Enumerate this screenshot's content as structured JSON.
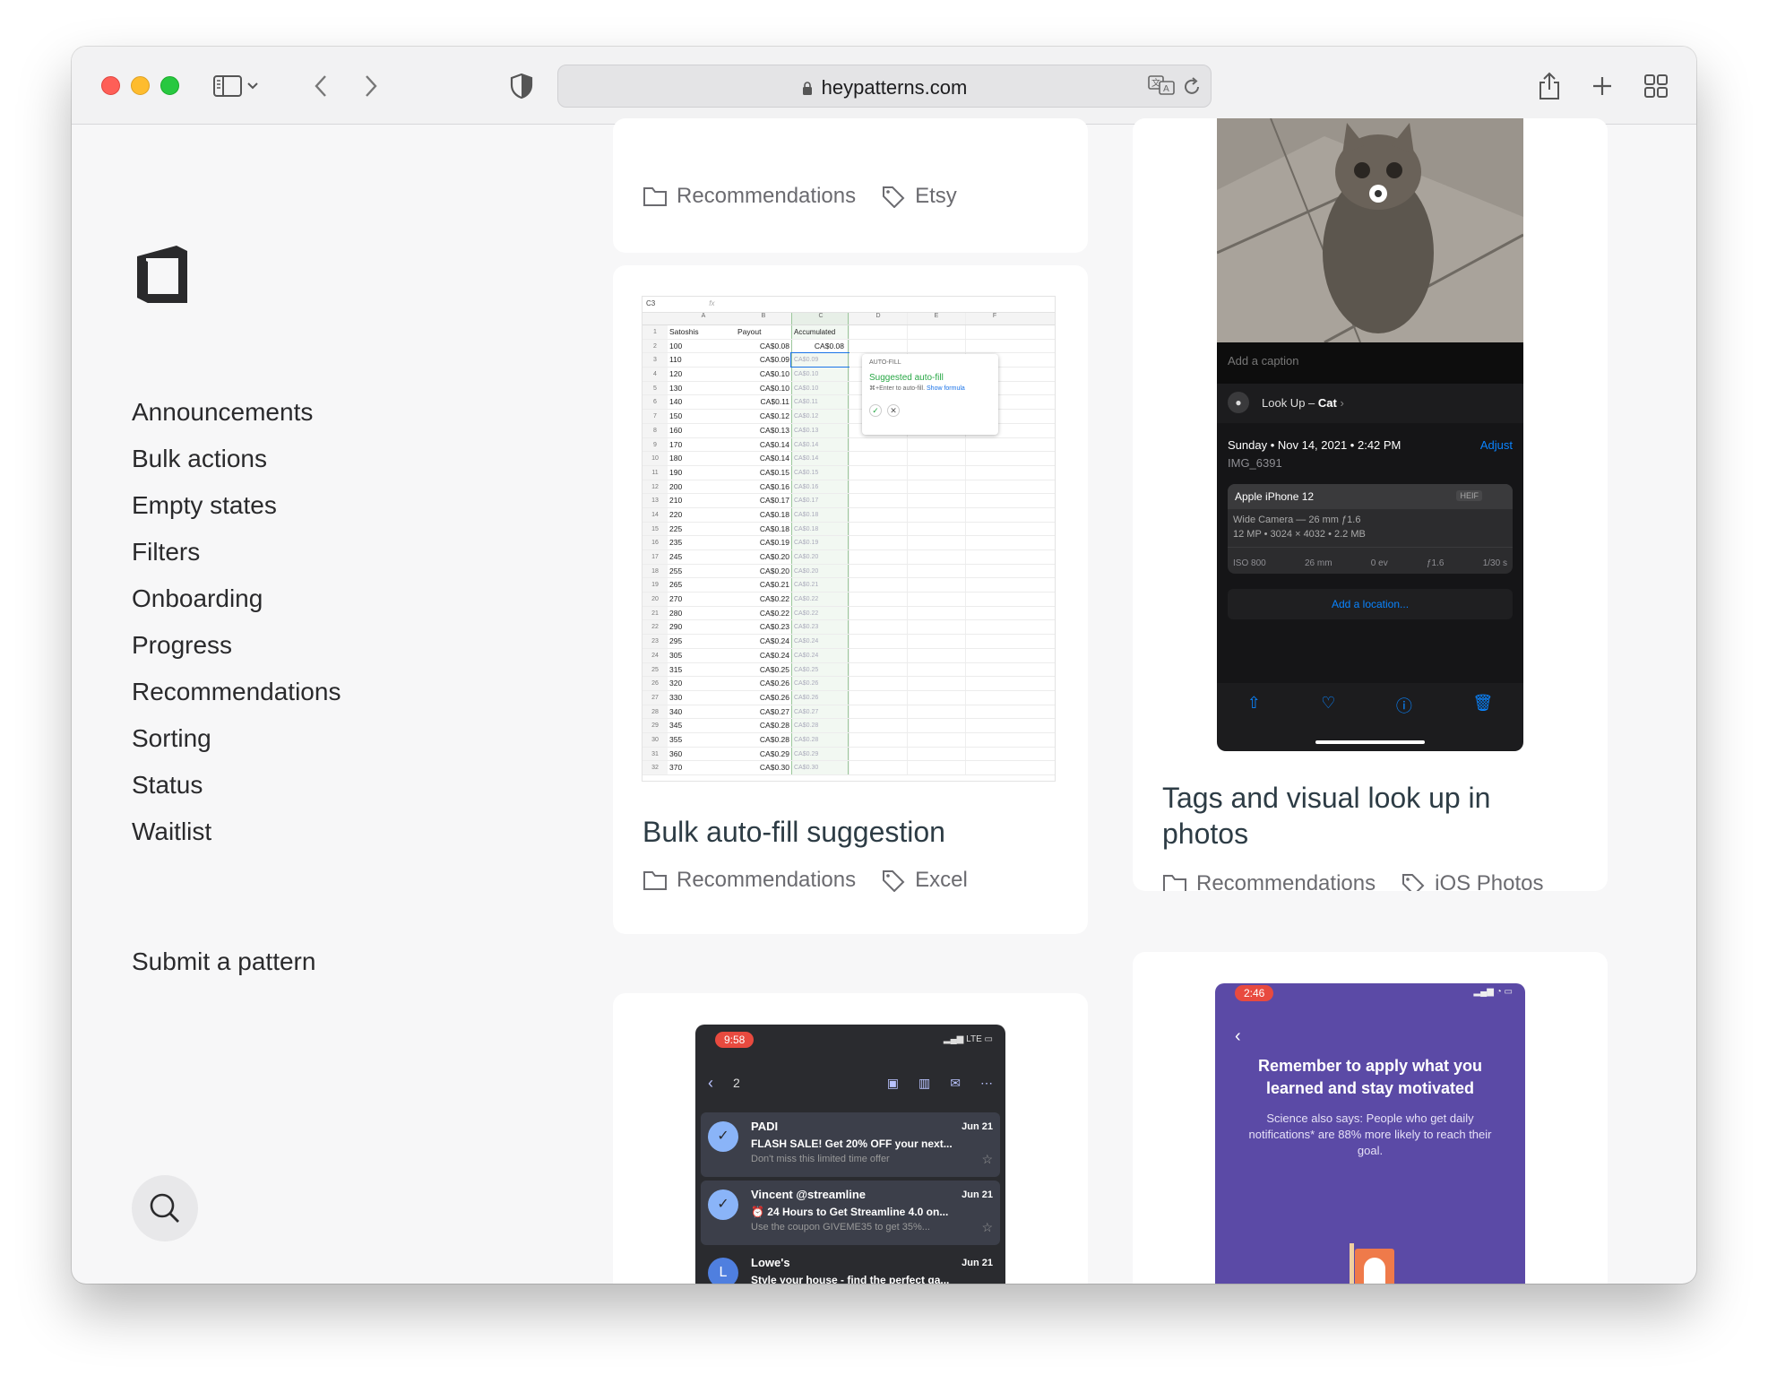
{
  "browser": {
    "url": "heypatterns.com"
  },
  "sidebar": {
    "nav": [
      {
        "label": "Announcements"
      },
      {
        "label": "Bulk actions"
      },
      {
        "label": "Empty states"
      },
      {
        "label": "Filters"
      },
      {
        "label": "Onboarding"
      },
      {
        "label": "Progress"
      },
      {
        "label": "Recommendations"
      },
      {
        "label": "Sorting"
      },
      {
        "label": "Status"
      },
      {
        "label": "Waitlist"
      }
    ],
    "submit": "Submit a pattern"
  },
  "cards": {
    "top_left": {
      "category": "Recommendations",
      "tag": "Etsy"
    },
    "bulk": {
      "title": "Bulk auto-fill suggestion",
      "category": "Recommendations",
      "tag": "Excel",
      "sheet": {
        "cell_ref": "C3",
        "fx": "fx",
        "headers": [
          "A",
          "B",
          "C",
          "D",
          "E",
          "F"
        ],
        "row1": [
          "Satoshis",
          "Payout",
          "Accumulated"
        ],
        "rows": [
          [
            "2",
            "100",
            "CA$0.08",
            "CA$0.08"
          ],
          [
            "3",
            "110",
            "CA$0.09",
            "CA$0.09"
          ],
          [
            "4",
            "120",
            "CA$0.10",
            "CA$0.10"
          ],
          [
            "5",
            "130",
            "CA$0.10",
            "CA$0.10"
          ],
          [
            "6",
            "140",
            "CA$0.11",
            "CA$0.11"
          ],
          [
            "7",
            "150",
            "CA$0.12",
            "CA$0.12"
          ],
          [
            "8",
            "160",
            "CA$0.13",
            "CA$0.13"
          ],
          [
            "9",
            "170",
            "CA$0.14",
            "CA$0.14"
          ],
          [
            "10",
            "180",
            "CA$0.14",
            "CA$0.14"
          ],
          [
            "11",
            "190",
            "CA$0.15",
            "CA$0.15"
          ],
          [
            "12",
            "200",
            "CA$0.16",
            "CA$0.16"
          ],
          [
            "13",
            "210",
            "CA$0.17",
            "CA$0.17"
          ],
          [
            "14",
            "220",
            "CA$0.18",
            "CA$0.18"
          ],
          [
            "15",
            "225",
            "CA$0.18",
            "CA$0.18"
          ],
          [
            "16",
            "235",
            "CA$0.19",
            "CA$0.19"
          ],
          [
            "17",
            "245",
            "CA$0.20",
            "CA$0.20"
          ],
          [
            "18",
            "255",
            "CA$0.20",
            "CA$0.20"
          ],
          [
            "19",
            "265",
            "CA$0.21",
            "CA$0.21"
          ],
          [
            "20",
            "270",
            "CA$0.22",
            "CA$0.22"
          ],
          [
            "21",
            "280",
            "CA$0.22",
            "CA$0.22"
          ],
          [
            "22",
            "290",
            "CA$0.23",
            "CA$0.23"
          ],
          [
            "23",
            "295",
            "CA$0.24",
            "CA$0.24"
          ],
          [
            "24",
            "305",
            "CA$0.24",
            "CA$0.24"
          ],
          [
            "25",
            "315",
            "CA$0.25",
            "CA$0.25"
          ],
          [
            "26",
            "320",
            "CA$0.26",
            "CA$0.26"
          ],
          [
            "27",
            "330",
            "CA$0.26",
            "CA$0.26"
          ],
          [
            "28",
            "340",
            "CA$0.27",
            "CA$0.27"
          ],
          [
            "29",
            "345",
            "CA$0.28",
            "CA$0.28"
          ],
          [
            "30",
            "355",
            "CA$0.28",
            "CA$0.28"
          ],
          [
            "31",
            "360",
            "CA$0.29",
            "CA$0.29"
          ],
          [
            "32",
            "370",
            "CA$0.30",
            "CA$0.30"
          ]
        ],
        "popup": {
          "heading": "AUTO-FILL",
          "title": "Suggested auto-fill",
          "hint": "⌘+Enter to auto-fill.",
          "link": "Show formula"
        }
      }
    },
    "photos": {
      "title": "Tags and visual look up in photos",
      "category": "Recommendations",
      "tag": "iOS Photos",
      "screen": {
        "caption_placeholder": "Add a caption",
        "lookup_prefix": "Look Up –",
        "lookup_subject": "Cat",
        "date": "Sunday • Nov 14, 2021 • 2:42 PM",
        "adjust": "Adjust",
        "filename": "IMG_6391",
        "device": "Apple iPhone 12",
        "format": "HEIF",
        "lens": "Wide Camera — 26 mm ƒ1.6",
        "specs": "12 MP • 3024 × 4032 • 2.2 MB",
        "exif": [
          "ISO 800",
          "26 mm",
          "0 ev",
          "ƒ1.6",
          "1/30 s"
        ],
        "location": "Add a location..."
      }
    },
    "mail": {
      "time": "9:58",
      "network": "LTE",
      "count": "2",
      "items": [
        {
          "sender": "PADI",
          "date": "Jun 21",
          "subject": "FLASH SALE! Get 20% OFF your next...",
          "preview": "Don't miss this limited time offer"
        },
        {
          "sender": "Vincent @streamline",
          "date": "Jun 21",
          "subject": "⏰ 24 Hours to Get Streamline 4.0 on...",
          "preview": "Use the coupon GIVEME35 to get 35%..."
        },
        {
          "sender": "Lowe's",
          "date": "Jun 21",
          "subject": "Style your house - find the perfect ga...",
          "avatar": "L"
        }
      ]
    },
    "motivation": {
      "time": "2:46",
      "title": "Remember to apply what you learned and stay motivated",
      "body": "Science also says: People who get daily notifications* are 88% more likely to reach their goal."
    }
  },
  "colors": {
    "title": "#2d3c45",
    "meta": "#6b6b70",
    "purple": "#5b4aa6",
    "green": "#28a745",
    "ios_blue": "#0a84ff"
  }
}
